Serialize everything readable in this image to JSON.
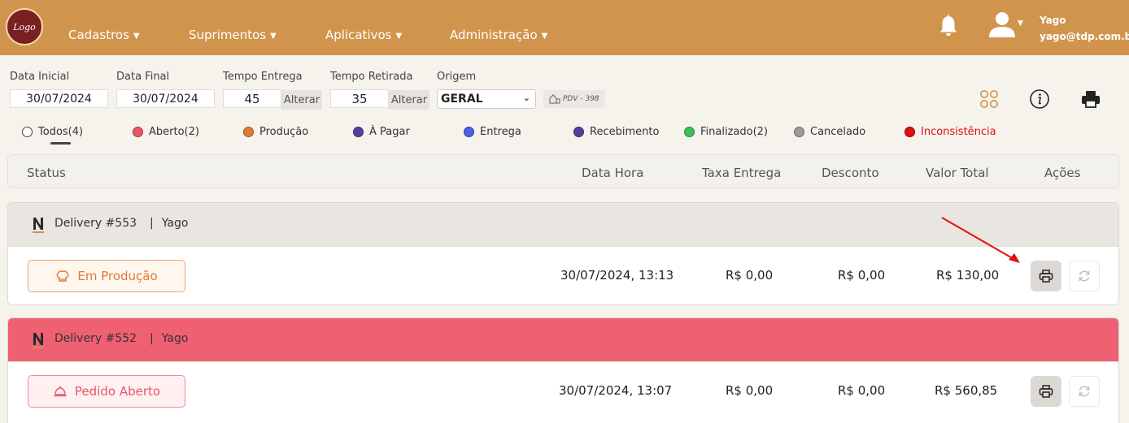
{
  "navbar": {
    "logo_text": "Logo",
    "menu": [
      {
        "label": "Cadastros"
      },
      {
        "label": "Suprimentos"
      },
      {
        "label": "Aplicativos"
      },
      {
        "label": "Administração"
      }
    ],
    "user_name": "Yago",
    "user_email": "yago@tdp.com.br",
    "icons": [
      "bell-icon",
      "user-icon"
    ]
  },
  "filters": {
    "data_inicial_label": "Data Inicial",
    "data_inicial_value": "30/07/2024",
    "data_final_label": "Data Final",
    "data_final_value": "30/07/2024",
    "tempo_entrega_label": "Tempo Entrega",
    "tempo_entrega_value": "45",
    "tempo_retirada_label": "Tempo Retirada",
    "tempo_retirada_value": "35",
    "alterar_label": "Alterar",
    "origem_label": "Origem",
    "origem_value": "GERAL",
    "pdv_label": "PDV - 398"
  },
  "status_tabs": [
    {
      "label": "Todos(4)",
      "color": "#ffffff",
      "selected": true
    },
    {
      "label": "Aberto(2)",
      "color": "#e8566a"
    },
    {
      "label": "Produção",
      "color": "#e07b36"
    },
    {
      "label": "À Pagar",
      "color": "#5a3e9e"
    },
    {
      "label": "Entrega",
      "color": "#4a63e0"
    },
    {
      "label": "Recebimento",
      "color": "#5a3e9e"
    },
    {
      "label": "Finalizado(2)",
      "color": "#3fbf5a"
    },
    {
      "label": "Cancelado",
      "color": "#9a9a9a"
    },
    {
      "label": "Inconsistência",
      "color": "#e01010"
    }
  ],
  "table": {
    "headers": [
      "Status",
      "Data Hora",
      "Taxa Entrega",
      "Desconto",
      "Valor Total",
      "Ações"
    ]
  },
  "orders": [
    {
      "title": "Delivery #553",
      "customer": "Yago",
      "status": "Em Produção",
      "status_color": "#e07b36",
      "header_color": "#e9e6e2",
      "datetime": "30/07/2024, 13:13",
      "taxa": "R$ 0,00",
      "desconto": "R$ 0,00",
      "total": "R$ 130,00"
    },
    {
      "title": "Delivery #552",
      "customer": "Yago",
      "status": "Pedido Aberto",
      "status_color": "#e8566a",
      "header_color": "#f06073",
      "datetime": "30/07/2024, 13:07",
      "taxa": "R$ 0,00",
      "desconto": "R$ 0,00",
      "total": "R$ 560,85"
    }
  ],
  "colors": {
    "navbar": "#d1944c",
    "arrow": "#e01010"
  }
}
